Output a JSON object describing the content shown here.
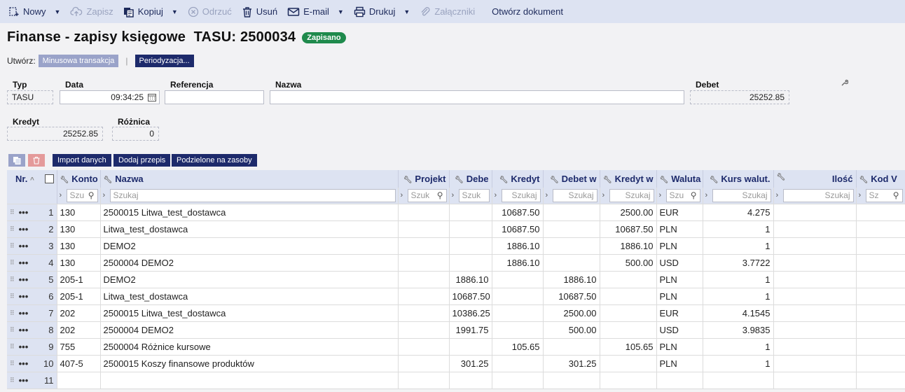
{
  "toolbar": {
    "new": "Nowy",
    "save": "Zapisz",
    "copy": "Kopiuj",
    "discard": "Odrzuć",
    "delete": "Usuń",
    "email": "E-mail",
    "print": "Drukuj",
    "attachments": "Załączniki",
    "open_document": "Otwórz dokument"
  },
  "header": {
    "title": "Finanse - zapisy księgowe  TASU: 2500034",
    "status": "Zapisano"
  },
  "create": {
    "label": "Utwórz:",
    "minus_transaction": "Minusowa transakcja",
    "periodization": "Periodyzacja..."
  },
  "form": {
    "type_label": "Typ",
    "type_value": "TASU",
    "date_label": "Data",
    "date_value": "09:34:25",
    "reference_label": "Referencja",
    "reference_value": "",
    "name_label": "Nazwa",
    "name_value": "",
    "debit_label": "Debet",
    "debit_value": "25252.85",
    "credit_label": "Kredyt",
    "credit_value": "25252.85",
    "difference_label": "Różnica",
    "difference_value": "0"
  },
  "actions": {
    "import": "Import danych",
    "add_template": "Dodaj przepis",
    "split": "Podzielone na zasoby"
  },
  "grid": {
    "columns": {
      "nr": "Nr.",
      "konto": "Konto",
      "nazwa": "Nazwa",
      "projekt": "Projekt",
      "debet": "Debe",
      "kredyt": "Kredyt",
      "debet_w": "Debet w",
      "kredyt_w": "Kredyt w",
      "waluta": "Waluta",
      "kurs": "Kurs walut.",
      "ilosc": "Ilość",
      "kod": "Kod V"
    },
    "search": {
      "konto": "Szu",
      "nazwa": "Szukaj",
      "projekt": "Szuk",
      "debet": "Szuk",
      "kredyt": "Szukaj",
      "debet_w": "Szukaj",
      "kredyt_w": "Szukaj",
      "waluta": "Szu",
      "kurs": "Szukaj",
      "ilosc": "Szukaj",
      "kod": "Sz"
    },
    "rows": [
      {
        "nr": "1",
        "konto": "130",
        "nazwa": "2500015 Litwa_test_dostawca",
        "projekt": "",
        "debet": "",
        "kredyt": "10687.50",
        "debet_w": "",
        "kredyt_w": "2500.00",
        "waluta": "EUR",
        "kurs": "4.275",
        "ilosc": "",
        "kod": ""
      },
      {
        "nr": "2",
        "konto": "130",
        "nazwa": "Litwa_test_dostawca",
        "projekt": "",
        "debet": "",
        "kredyt": "10687.50",
        "debet_w": "",
        "kredyt_w": "10687.50",
        "waluta": "PLN",
        "kurs": "1",
        "ilosc": "",
        "kod": ""
      },
      {
        "nr": "3",
        "konto": "130",
        "nazwa": "DEMO2",
        "projekt": "",
        "debet": "",
        "kredyt": "1886.10",
        "debet_w": "",
        "kredyt_w": "1886.10",
        "waluta": "PLN",
        "kurs": "1",
        "ilosc": "",
        "kod": ""
      },
      {
        "nr": "4",
        "konto": "130",
        "nazwa": "2500004 DEMO2",
        "projekt": "",
        "debet": "",
        "kredyt": "1886.10",
        "debet_w": "",
        "kredyt_w": "500.00",
        "waluta": "USD",
        "kurs": "3.7722",
        "ilosc": "",
        "kod": ""
      },
      {
        "nr": "5",
        "konto": "205-1",
        "nazwa": "DEMO2",
        "projekt": "",
        "debet": "1886.10",
        "kredyt": "",
        "debet_w": "1886.10",
        "kredyt_w": "",
        "waluta": "PLN",
        "kurs": "1",
        "ilosc": "",
        "kod": ""
      },
      {
        "nr": "6",
        "konto": "205-1",
        "nazwa": "Litwa_test_dostawca",
        "projekt": "",
        "debet": "10687.50",
        "kredyt": "",
        "debet_w": "10687.50",
        "kredyt_w": "",
        "waluta": "PLN",
        "kurs": "1",
        "ilosc": "",
        "kod": ""
      },
      {
        "nr": "7",
        "konto": "202",
        "nazwa": "2500015 Litwa_test_dostawca",
        "projekt": "",
        "debet": "10386.25",
        "kredyt": "",
        "debet_w": "2500.00",
        "kredyt_w": "",
        "waluta": "EUR",
        "kurs": "4.1545",
        "ilosc": "",
        "kod": ""
      },
      {
        "nr": "8",
        "konto": "202",
        "nazwa": "2500004 DEMO2",
        "projekt": "",
        "debet": "1991.75",
        "kredyt": "",
        "debet_w": "500.00",
        "kredyt_w": "",
        "waluta": "USD",
        "kurs": "3.9835",
        "ilosc": "",
        "kod": ""
      },
      {
        "nr": "9",
        "konto": "755",
        "nazwa": "2500004 Różnice kursowe",
        "projekt": "",
        "debet": "",
        "kredyt": "105.65",
        "debet_w": "",
        "kredyt_w": "105.65",
        "waluta": "PLN",
        "kurs": "1",
        "ilosc": "",
        "kod": ""
      },
      {
        "nr": "10",
        "konto": "407-5",
        "nazwa": "2500015 Koszy finansowe produktów",
        "projekt": "",
        "debet": "301.25",
        "kredyt": "",
        "debet_w": "301.25",
        "kredyt_w": "",
        "waluta": "PLN",
        "kurs": "1",
        "ilosc": "",
        "kod": ""
      },
      {
        "nr": "11",
        "konto": "",
        "nazwa": "",
        "projekt": "",
        "debet": "",
        "kredyt": "",
        "debet_w": "",
        "kredyt_w": "",
        "waluta": "",
        "kurs": "",
        "ilosc": "",
        "kod": ""
      }
    ]
  }
}
